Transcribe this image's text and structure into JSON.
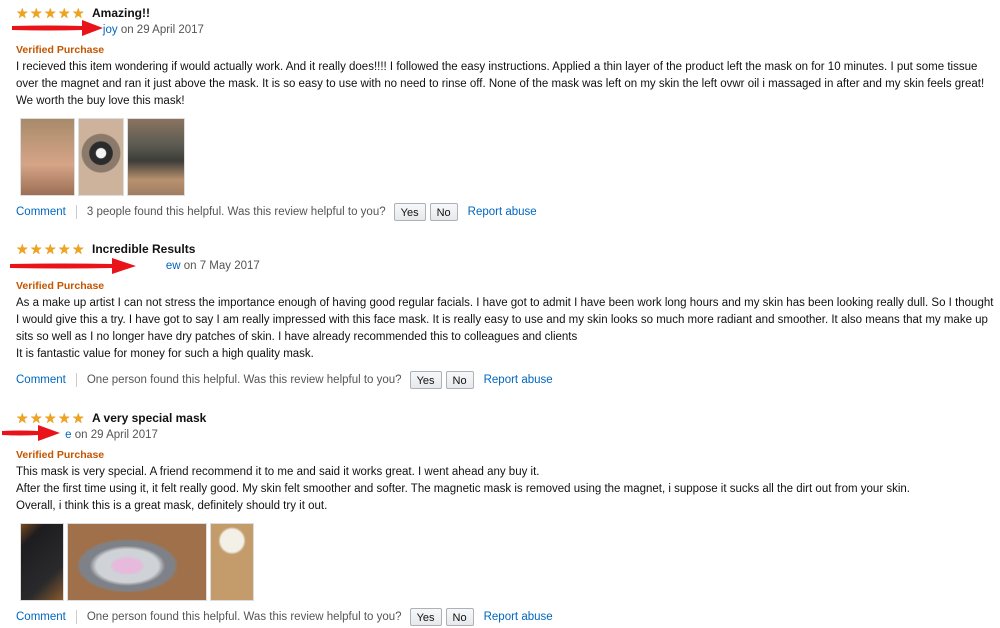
{
  "reviews": [
    {
      "title": "Amazing!!",
      "author_fragment": "joy",
      "date": "on 29 April 2017",
      "verified": "Verified Purchase",
      "body": "I recieved this item wondering if would actually work. And it really does!!!! I followed the easy instructions. Applied a thin layer of the product left the mask on for 10 minutes. I put some tissue over the magnet and ran it just above the mask. It is so easy to use with no need to rinse off. None of the mask was left on my skin the left ovwr oil i massaged in after and my skin feels great! We worth the buy love this mask!",
      "comment_label": "Comment",
      "helpful_text": "3 people found this helpful. Was this review helpful to you?",
      "yes_label": "Yes",
      "no_label": "No",
      "report_label": "Report abuse"
    },
    {
      "title": "Incredible Results",
      "author_fragment": "ew",
      "date": "on 7 May 2017",
      "verified": "Verified Purchase",
      "body_lines": [
        "As a make up artist I can not stress the importance enough of having good regular facials. I have got to admit I have been work long hours and my skin has been looking really dull. So I thought I would give this a try. I have got to say I am really impressed with this face mask. It is really easy to use and my skin looks so much more radiant and smoother. It also means that my make up sits so well as I no longer have dry patches of skin. I have already recommended this to colleagues and clients",
        "It is fantastic value for money for such a high quality mask."
      ],
      "comment_label": "Comment",
      "helpful_text": "One person found this helpful. Was this review helpful to you?",
      "yes_label": "Yes",
      "no_label": "No",
      "report_label": "Report abuse"
    },
    {
      "title": "A very special mask",
      "author_fragment": "e",
      "date": "on 29 April 2017",
      "verified": "Verified Purchase",
      "body_lines": [
        "This mask is very special. A friend recommend it to me and said it works great. I went ahead any buy it.",
        "After the first time using it, it felt really good. My skin felt smoother and softer. The magnetic mask is removed using the magnet, i suppose it sucks all the dirt out from your skin.",
        "Overall, i think this is a great mask, definitely should try it out."
      ],
      "comment_label": "Comment",
      "helpful_text": "One person found this helpful. Was this review helpful to you?",
      "yes_label": "Yes",
      "no_label": "No",
      "report_label": "Report abuse"
    }
  ],
  "rating": "5",
  "colors": {
    "star": "#f0a41b",
    "link": "#0066c0",
    "verified": "#c45500",
    "arrow": "#e8141a"
  }
}
